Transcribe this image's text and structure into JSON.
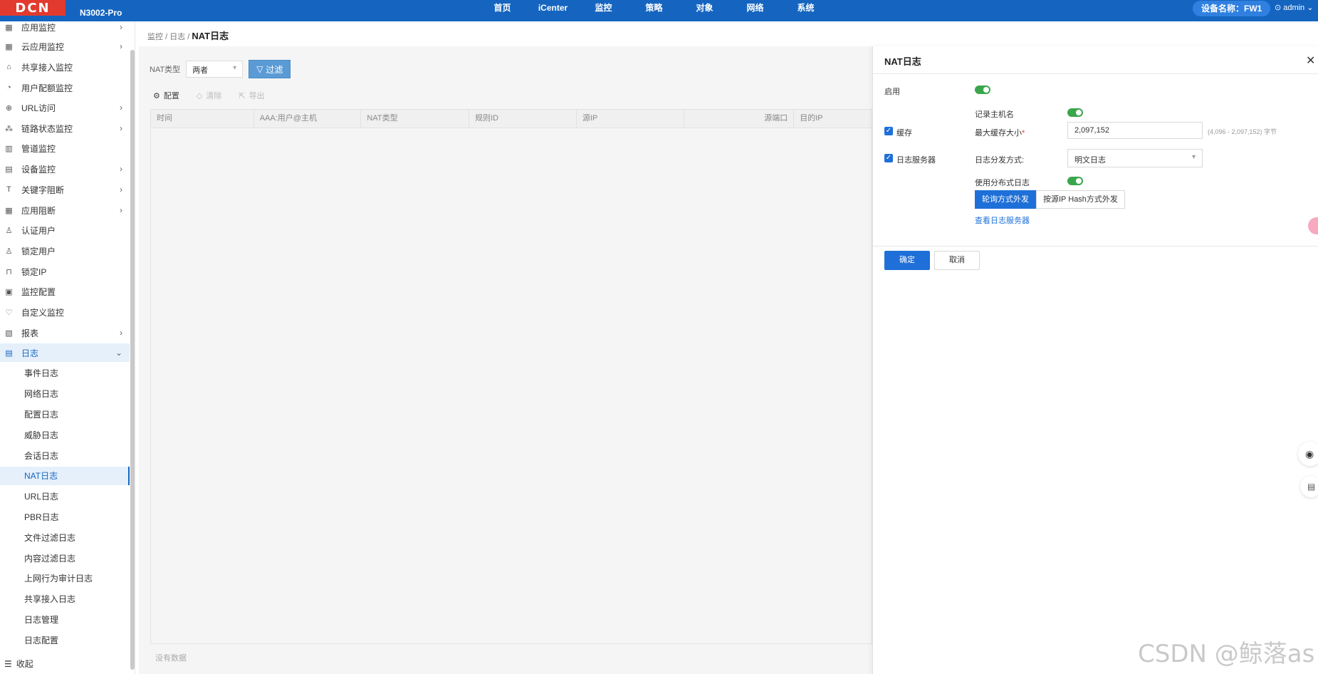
{
  "topbar": {
    "logo": "DCN",
    "model": "N3002-Pro",
    "nav": [
      {
        "label": "首页",
        "active": false
      },
      {
        "label": "iCenter",
        "active": false
      },
      {
        "label": "监控",
        "active": true
      },
      {
        "label": "策略",
        "active": false
      },
      {
        "label": "对象",
        "active": false
      },
      {
        "label": "网络",
        "active": false
      },
      {
        "label": "系统",
        "active": false
      }
    ],
    "device_name": "设备名称：FW1",
    "user": "admin"
  },
  "sidebar": {
    "items": [
      {
        "label": "应用监控",
        "icon": "grid-icon",
        "has_children": true
      },
      {
        "label": "云应用监控",
        "icon": "grid-icon",
        "has_children": true
      },
      {
        "label": "共享接入监控",
        "icon": "share-icon",
        "has_children": false
      },
      {
        "label": "用户配额监控",
        "icon": "quota-icon",
        "has_children": false
      },
      {
        "label": "URL访问",
        "icon": "globe-icon",
        "has_children": true
      },
      {
        "label": "链路状态监控",
        "icon": "link-icon",
        "has_children": true
      },
      {
        "label": "管道监控",
        "icon": "pipe-icon",
        "has_children": false
      },
      {
        "label": "设备监控",
        "icon": "device-icon",
        "has_children": true
      },
      {
        "label": "关键字阻断",
        "icon": "keyword-icon",
        "has_children": true
      },
      {
        "label": "应用阻断",
        "icon": "grid-icon",
        "has_children": true
      },
      {
        "label": "认证用户",
        "icon": "user-icon",
        "has_children": false
      },
      {
        "label": "锁定用户",
        "icon": "user-lock-icon",
        "has_children": false
      },
      {
        "label": "锁定IP",
        "icon": "lock-icon",
        "has_children": false
      },
      {
        "label": "监控配置",
        "icon": "monitor-config-icon",
        "has_children": false
      },
      {
        "label": "自定义监控",
        "icon": "custom-monitor-icon",
        "has_children": false
      },
      {
        "label": "报表",
        "icon": "report-icon",
        "has_children": true
      },
      {
        "label": "日志",
        "icon": "log-icon",
        "has_children": true,
        "open": true
      }
    ],
    "log_children": [
      {
        "label": "事件日志",
        "active": false
      },
      {
        "label": "网络日志",
        "active": false
      },
      {
        "label": "配置日志",
        "active": false
      },
      {
        "label": "威胁日志",
        "active": false
      },
      {
        "label": "会话日志",
        "active": false
      },
      {
        "label": "NAT日志",
        "active": true
      },
      {
        "label": "URL日志",
        "active": false
      },
      {
        "label": "PBR日志",
        "active": false
      },
      {
        "label": "文件过滤日志",
        "active": false
      },
      {
        "label": "内容过滤日志",
        "active": false
      },
      {
        "label": "上网行为审计日志",
        "active": false
      },
      {
        "label": "共享接入日志",
        "active": false
      },
      {
        "label": "日志管理",
        "active": false
      },
      {
        "label": "日志配置",
        "active": false
      }
    ],
    "collapse_label": "收起"
  },
  "breadcrumb": {
    "level1": "监控",
    "level2": "日志",
    "current": "NAT日志",
    "sep": "/"
  },
  "filter": {
    "nat_type_label": "NAT类型",
    "nat_type_value": "两者",
    "filter_button": "过滤"
  },
  "toolbar": {
    "config": "配置",
    "clear": "清除",
    "export": "导出"
  },
  "table": {
    "columns": [
      "时间",
      "AAA:用户@主机",
      "NAT类型",
      "规则ID",
      "源IP",
      "源端口",
      "目的IP"
    ],
    "no_data": "没有数据"
  },
  "drawer": {
    "title": "NAT日志",
    "enable_label": "启用",
    "enable_on": true,
    "record_hostname_label": "记录主机名",
    "record_hostname_on": true,
    "cache_label": "缓存",
    "cache_checked": true,
    "max_cache_label": "最大缓存大小",
    "required_mark": "*",
    "max_cache_value": "2,097,152",
    "max_cache_hint": "(4,096 - 2,097,152) 字节",
    "log_server_label": "日志服务器",
    "log_server_checked": true,
    "dispatch_label": "日志分发方式:",
    "dispatch_value": "明文日志",
    "distributed_label": "使用分布式日志",
    "distributed_on": true,
    "mode_round_robin": "轮询方式外发",
    "mode_hash": "按源IP Hash方式外发",
    "view_servers_link": "查看日志服务器",
    "ok": "确定",
    "cancel": "取消"
  },
  "watermark": "CSDN @鲸落as",
  "colors": {
    "topbar": "#1565c0",
    "primary": "#1e70d8",
    "toggle_on": "#3aa64b",
    "logo": "#e23a2e"
  }
}
